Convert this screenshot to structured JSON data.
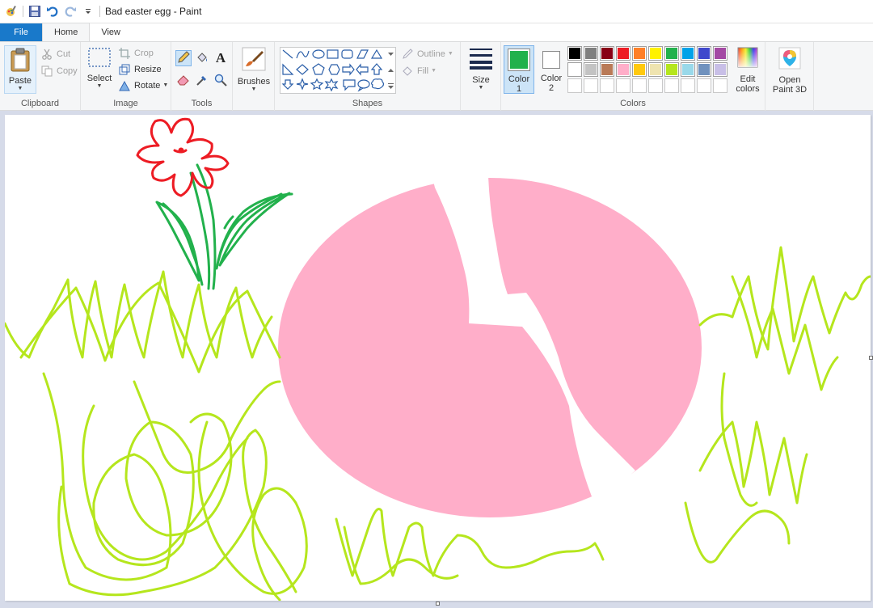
{
  "window": {
    "title": "Bad easter egg - Paint"
  },
  "tabs": [
    {
      "label": "File"
    },
    {
      "label": "Home"
    },
    {
      "label": "View"
    }
  ],
  "ribbon": {
    "clipboard": {
      "label": "Clipboard",
      "paste": "Paste",
      "cut": "Cut",
      "copy": "Copy"
    },
    "image": {
      "label": "Image",
      "select": "Select",
      "crop": "Crop",
      "resize": "Resize",
      "rotate": "Rotate"
    },
    "tools": {
      "label": "Tools"
    },
    "brushes": {
      "label": "Brushes"
    },
    "shapes": {
      "label": "Shapes",
      "outline": "Outline",
      "fill": "Fill"
    },
    "size": {
      "label": "Size"
    },
    "colors": {
      "label": "Colors",
      "color1_line1": "Color",
      "color1_line2": "1",
      "color2_line1": "Color",
      "color2_line2": "2",
      "edit_line1": "Edit",
      "edit_line2": "colors",
      "color1": "#22b14c",
      "color2": "#ffffff",
      "palette_row1": [
        "#000000",
        "#7f7f7f",
        "#880015",
        "#ed1c24",
        "#ff7f27",
        "#fff200",
        "#22b14c",
        "#00a2e8",
        "#3f48cc",
        "#a349a4"
      ],
      "palette_row2": [
        "#ffffff",
        "#c3c3c3",
        "#b97a57",
        "#ffaec9",
        "#ffc90e",
        "#efe4b0",
        "#b5e61d",
        "#99d9ea",
        "#7092be",
        "#c8bfe7"
      ]
    },
    "paint3d": {
      "line1": "Open",
      "line2": "Paint 3D"
    }
  },
  "canvas": {
    "egg_color": "#ffaec9",
    "grass_color": "#b5e61d",
    "flower_color": "#ed1c24",
    "stem_color": "#22b14c"
  }
}
